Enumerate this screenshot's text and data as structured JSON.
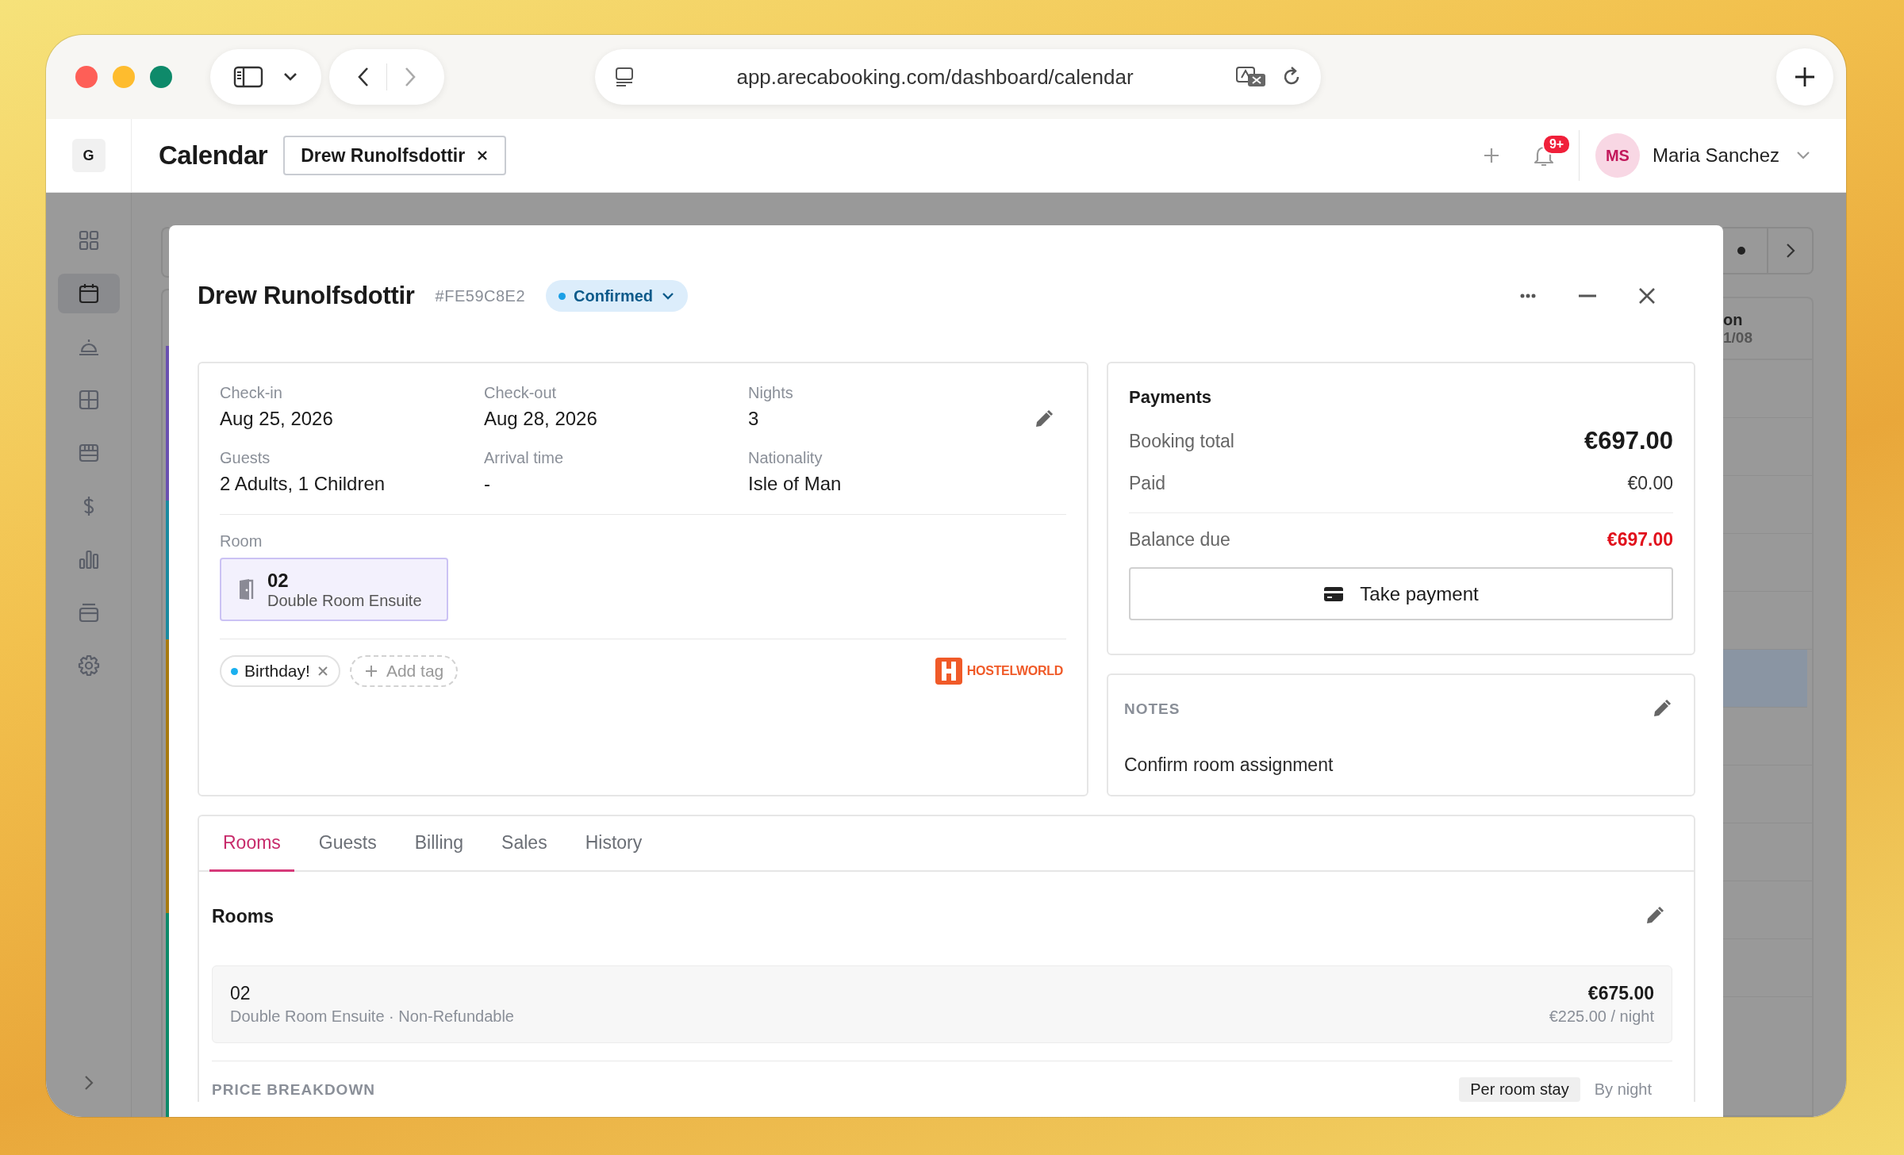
{
  "browser": {
    "url": "app.arecabooking.com/dashboard/calendar"
  },
  "header": {
    "workspace": "G",
    "title": "Calendar",
    "open_tab": "Drew Runolfsdottir",
    "notifications_badge": "9+",
    "user": {
      "initials": "MS",
      "name": "Maria Sanchez"
    }
  },
  "sidebar": {
    "items": [
      {
        "kind": "grid",
        "selected": false
      },
      {
        "kind": "calendar",
        "selected": true
      },
      {
        "kind": "bell",
        "selected": false
      },
      {
        "kind": "table",
        "selected": false
      },
      {
        "kind": "store",
        "selected": false
      },
      {
        "kind": "dollar",
        "selected": false
      },
      {
        "kind": "chart",
        "selected": false
      },
      {
        "kind": "stack",
        "selected": false
      },
      {
        "kind": "settings",
        "selected": false
      }
    ]
  },
  "calendar": {
    "day_name": "on",
    "day_date": "1/08"
  },
  "booking": {
    "guest_name": "Drew Runolfsdottir",
    "reference": "#FE59C8E2",
    "status": "Confirmed",
    "details": [
      {
        "label": "Check-in",
        "value": "Aug 25, 2026"
      },
      {
        "label": "Check-out",
        "value": "Aug 28, 2026"
      },
      {
        "label": "Nights",
        "value": "3"
      },
      {
        "label": "Guests",
        "value": "2 Adults, 1 Children"
      },
      {
        "label": "Arrival time",
        "value": "-"
      },
      {
        "label": "Nationality",
        "value": "Isle of Man"
      }
    ],
    "room_label": "Room",
    "room": {
      "number": "02",
      "type": "Double Room Ensuite"
    },
    "tags": [
      {
        "label": "Birthday!",
        "color": "#1ab0ef"
      }
    ],
    "add_tag": "Add tag",
    "source": "HOSTELWORLD"
  },
  "payments": {
    "title": "Payments",
    "rows": [
      {
        "label": "Booking total",
        "value": "€697.00",
        "kind": "total"
      },
      {
        "label": "Paid",
        "value": "€0.00",
        "kind": "plain"
      },
      {
        "label": "Balance due",
        "value": "€697.00",
        "kind": "due"
      }
    ],
    "button": "Take payment"
  },
  "notes": {
    "title": "NOTES",
    "text": "Confirm room assignment"
  },
  "tabs": [
    {
      "label": "Rooms",
      "selected": true
    },
    {
      "label": "Guests",
      "selected": false
    },
    {
      "label": "Billing",
      "selected": false
    },
    {
      "label": "Sales",
      "selected": false
    },
    {
      "label": "History",
      "selected": false
    }
  ],
  "rooms": {
    "title": "Rooms",
    "items": [
      {
        "number": "02",
        "description": "Double Room Ensuite · Non-Refundable",
        "total": "€675.00",
        "rate": "€225.00 / night"
      }
    ]
  },
  "price_breakdown": {
    "title": "PRICE BREAKDOWN",
    "modes": [
      {
        "label": "Per room stay",
        "selected": true
      },
      {
        "label": "By night",
        "selected": false
      }
    ]
  }
}
